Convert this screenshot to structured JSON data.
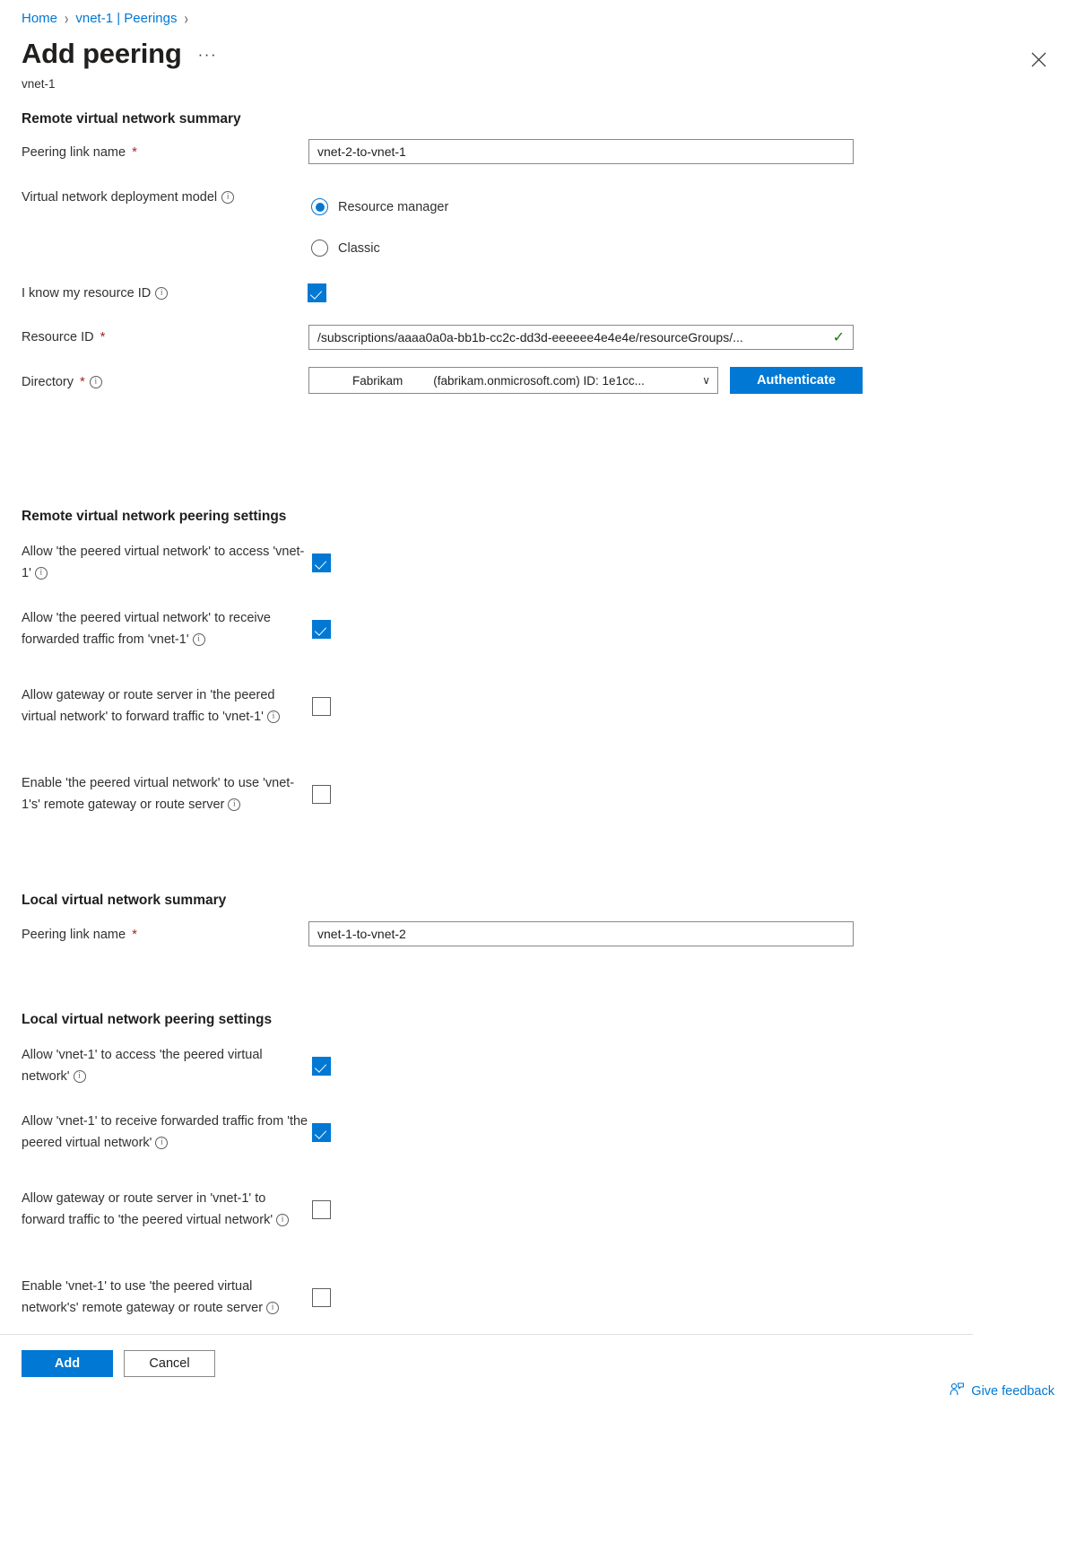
{
  "breadcrumb": {
    "items": [
      {
        "label": "Home"
      },
      {
        "label": "vnet-1 | Peerings"
      }
    ],
    "separator": "›"
  },
  "header": {
    "title": "Add peering",
    "subtitle": "vnet-1",
    "overflow_label": "···",
    "close_icon": "close-icon"
  },
  "remote_summary": {
    "heading": "Remote virtual network summary",
    "peering_link_name": {
      "label": "Peering link name",
      "required": "*",
      "value": "vnet-2-to-vnet-1"
    },
    "deployment_model": {
      "label": "Virtual network deployment model",
      "options": [
        {
          "label": "Resource manager",
          "selected": true
        },
        {
          "label": "Classic",
          "selected": false
        }
      ]
    },
    "know_resource_id": {
      "label": "I know my resource ID",
      "checked": true
    },
    "resource_id": {
      "label": "Resource ID",
      "required": "*",
      "value": "/subscriptions/aaaa0a0a-bb1b-cc2c-dd3d-eeeeee4e4e4e/resourceGroups/...",
      "validation_icon": "✓",
      "validation_color": "#107c10"
    },
    "directory": {
      "label": "Directory",
      "required": "*",
      "selected_name": "Fabrikam",
      "selected_detail": "(fabrikam.onmicrosoft.com) ID: 1e1cc...",
      "caret": "∨",
      "authenticate_label": "Authenticate"
    }
  },
  "remote_settings": {
    "heading": "Remote virtual network peering settings",
    "items": [
      {
        "text": "Allow 'the peered virtual network' to access 'vnet-1'",
        "checked": true
      },
      {
        "text": "Allow 'the peered virtual network' to receive forwarded traffic from 'vnet-1'",
        "checked": true
      },
      {
        "text": "Allow gateway or route server in 'the peered virtual network' to forward traffic to 'vnet-1'",
        "checked": false
      },
      {
        "text": "Enable 'the peered virtual network' to use 'vnet-1's' remote gateway or route server",
        "checked": false
      }
    ]
  },
  "local_summary": {
    "heading": "Local virtual network summary",
    "peering_link_name": {
      "label": "Peering link name",
      "required": "*",
      "value": "vnet-1-to-vnet-2"
    }
  },
  "local_settings": {
    "heading": "Local virtual network peering settings",
    "items": [
      {
        "text": "Allow 'vnet-1' to access 'the peered virtual network'",
        "checked": true
      },
      {
        "text": "Allow 'vnet-1' to receive forwarded traffic from 'the peered virtual network'",
        "checked": true
      },
      {
        "text": "Allow gateway or route server in 'vnet-1' to forward traffic to 'the peered virtual network'",
        "checked": false
      },
      {
        "text": "Enable 'vnet-1' to use 'the peered virtual network's' remote gateway or route server",
        "checked": false
      }
    ]
  },
  "footer": {
    "add_label": "Add",
    "cancel_label": "Cancel",
    "feedback_label": "Give feedback",
    "feedback_icon": "person-feedback-icon"
  },
  "colors": {
    "accent": "#0078d4",
    "link": "#0078d4",
    "required": "#a4262c",
    "success": "#107c10",
    "border": "#8a8886"
  }
}
